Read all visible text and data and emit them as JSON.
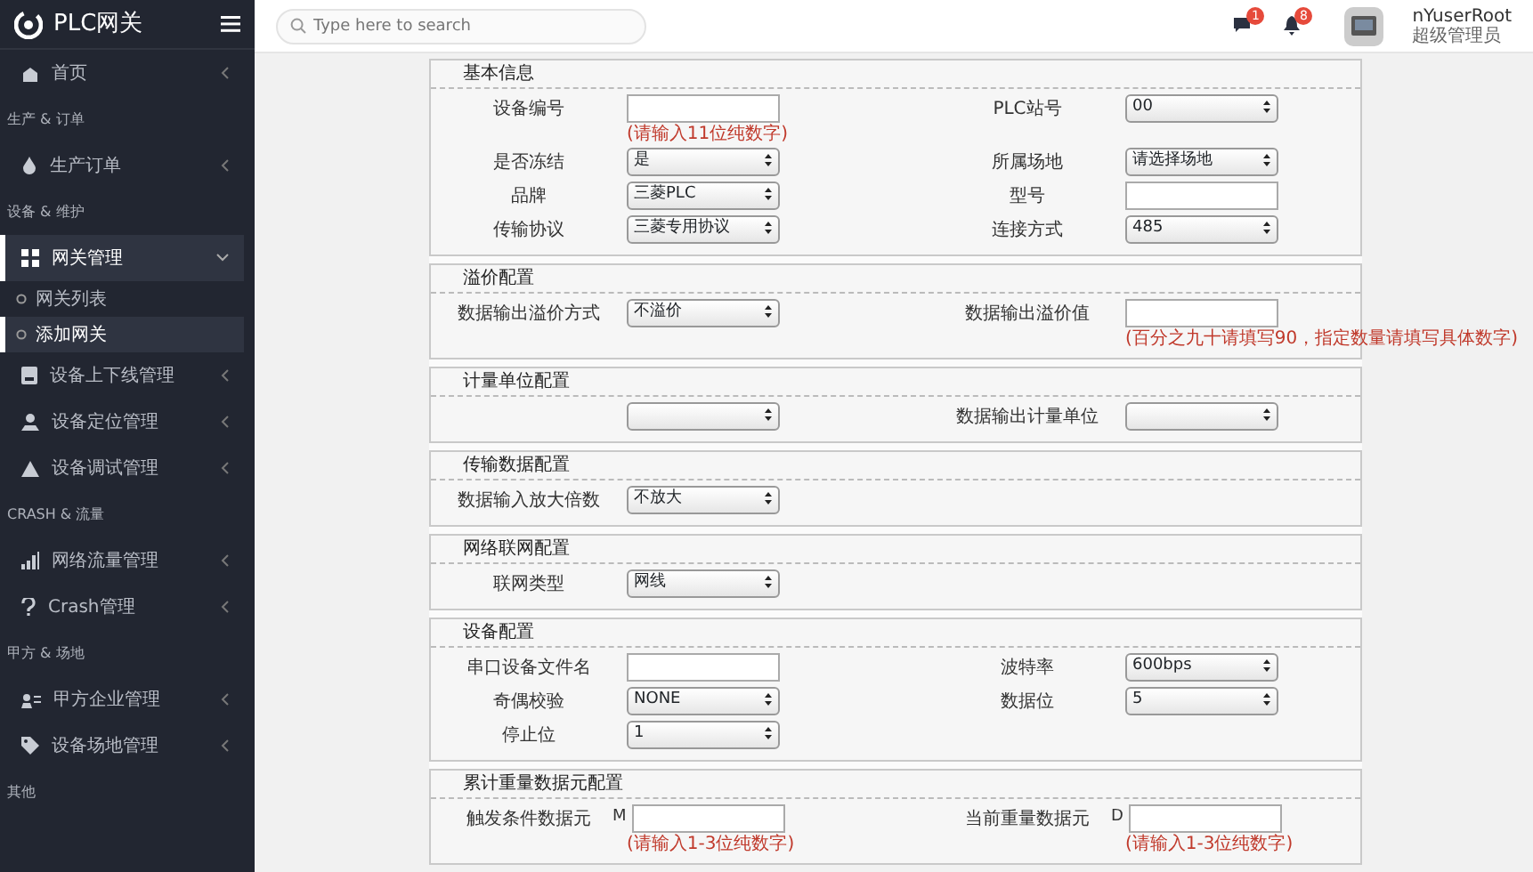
{
  "sidebar": {
    "logo": "PLC网关",
    "items": [
      {
        "kind": "item",
        "label": "首页",
        "selected": false,
        "expanded": false
      },
      {
        "kind": "header",
        "label": "生产 & 订单"
      },
      {
        "kind": "item",
        "label": "生产订单",
        "selected": false,
        "expanded": false
      },
      {
        "kind": "header",
        "label": "设备 & 维护"
      },
      {
        "kind": "item",
        "label": "网关管理",
        "selected": true,
        "expanded": true
      },
      {
        "kind": "subitem",
        "label": "网关列表",
        "selected": false
      },
      {
        "kind": "subitem",
        "label": "添加网关",
        "selected": true
      },
      {
        "kind": "item",
        "label": "设备上下线管理",
        "selected": false,
        "expanded": false
      },
      {
        "kind": "item",
        "label": "设备定位管理",
        "selected": false,
        "expanded": false
      },
      {
        "kind": "item",
        "label": "设备调试管理",
        "selected": false,
        "expanded": false
      },
      {
        "kind": "header",
        "label": "CRASH & 流量"
      },
      {
        "kind": "item",
        "label": "网络流量管理",
        "selected": false,
        "expanded": false
      },
      {
        "kind": "item",
        "label": "Crash管理",
        "selected": false,
        "expanded": false
      },
      {
        "kind": "header",
        "label": "甲方 & 场地"
      },
      {
        "kind": "item",
        "label": "甲方企业管理",
        "selected": false,
        "expanded": false
      },
      {
        "kind": "item",
        "label": "设备场地管理",
        "selected": false,
        "expanded": false
      },
      {
        "kind": "header",
        "label": "其他"
      }
    ]
  },
  "topbar": {
    "search": {
      "placeholder": "Type here to search"
    },
    "messages_badge": "1",
    "notifications_badge": "8",
    "user": {
      "name": "nYuserRoot",
      "role": "超级管理员"
    }
  },
  "sections": [
    {
      "title": "基本信息",
      "rows": [
        [
          {
            "label": "设备编号",
            "kind": "input",
            "hint": "(请输入11位纯数字)"
          },
          {
            "label": "PLC站号",
            "kind": "select",
            "value": "00"
          }
        ],
        [
          {
            "label": "是否冻结",
            "kind": "select",
            "value": "是"
          },
          {
            "label": "所属场地",
            "kind": "select",
            "value": "请选择场地"
          }
        ],
        [
          {
            "label": "品牌",
            "kind": "select",
            "value": "三菱PLC"
          },
          {
            "label": "型号",
            "kind": "input"
          }
        ],
        [
          {
            "label": "传输协议",
            "kind": "select",
            "value": "三菱专用协议"
          },
          {
            "label": "连接方式",
            "kind": "select",
            "value": "485"
          }
        ]
      ]
    },
    {
      "title": "溢价配置",
      "rows": [
        [
          {
            "label": "数据输出溢价方式",
            "kind": "select",
            "value": "不溢价"
          },
          {
            "label": "数据输出溢价值",
            "kind": "input",
            "hint": "(百分之九十请填写90，指定数量请填写具体数字)"
          }
        ]
      ]
    },
    {
      "title": "计量单位配置",
      "rows": [
        [
          {
            "kind": "select"
          },
          {
            "label": "数据输出计量单位",
            "kind": "select"
          }
        ]
      ]
    },
    {
      "title": "传输数据配置",
      "rows": [
        [
          {
            "label": "数据输入放大倍数",
            "kind": "select",
            "value": "不放大"
          }
        ]
      ]
    },
    {
      "title": "网络联网配置",
      "rows": [
        [
          {
            "label": "联网类型",
            "kind": "select",
            "value": "网线"
          }
        ]
      ]
    },
    {
      "title": "设备配置",
      "rows": [
        [
          {
            "label": "串口设备文件名",
            "kind": "input"
          },
          {
            "label": "波特率",
            "kind": "select",
            "value": "600bps"
          }
        ],
        [
          {
            "label": "奇偶校验",
            "kind": "select",
            "value": "NONE"
          },
          {
            "label": "数据位",
            "kind": "select",
            "value": "5"
          }
        ],
        [
          {
            "label": "停止位",
            "kind": "select",
            "value": "1"
          }
        ]
      ]
    },
    {
      "title": "累计重量数据元配置",
      "rows": [
        [
          {
            "label": "触发条件数据元",
            "prefix": "M",
            "kind": "input",
            "hint": "(请输入1-3位纯数字)"
          },
          {
            "label": "当前重量数据元",
            "prefix": "D",
            "kind": "input",
            "hint": "(请输入1-3位纯数字)"
          }
        ]
      ]
    }
  ]
}
